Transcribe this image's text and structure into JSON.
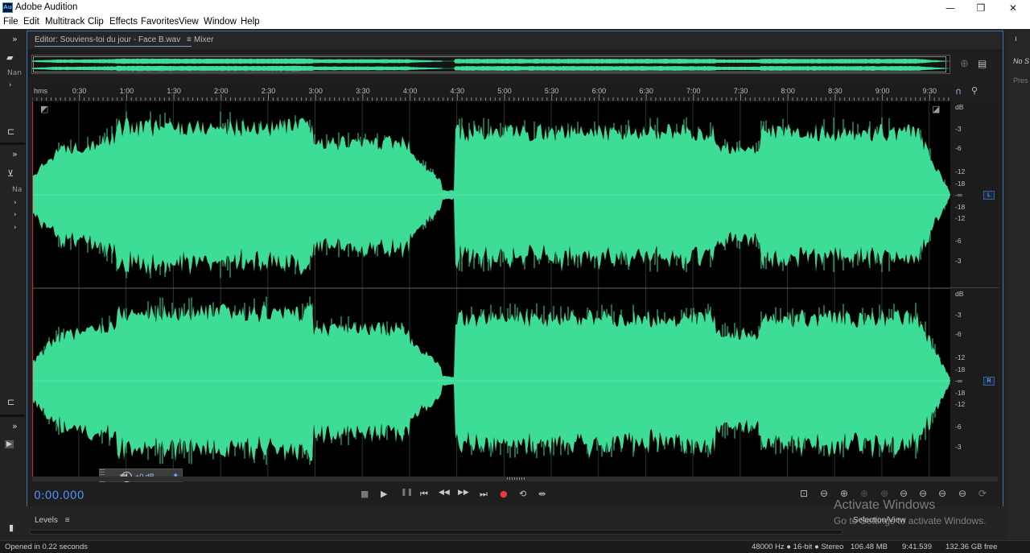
{
  "window": {
    "title": "Adobe Audition",
    "app_icon_text": "Au",
    "minimize_glyph": "—",
    "maximize_glyph": "❐",
    "close_glyph": "✕"
  },
  "menu": [
    "File",
    "Edit",
    "Multitrack",
    "Clip",
    "Effects",
    "Favorites",
    "View",
    "Window",
    "Help"
  ],
  "left_panel": {
    "files_label": "Nan",
    "effects_label": "Na"
  },
  "editor": {
    "tab_label": "Editor: Souviens-toi du jour - Face B.wav",
    "mixer_label": "Mixer",
    "menu_glyph": "≡"
  },
  "ruler": {
    "labels": [
      "hms",
      "0:30",
      "1:00",
      "1:30",
      "2:00",
      "2:30",
      "3:00",
      "3:30",
      "4:00",
      "4:30",
      "5:00",
      "5:30",
      "6:00",
      "6:30",
      "7:00",
      "7:30",
      "8:00",
      "8:30",
      "9:00",
      "9:30"
    ]
  },
  "db_scale": {
    "unit": "dB",
    "left_labels": [
      "-3",
      "-6",
      "-12",
      "-18",
      "-∞",
      "-18",
      "-12",
      "-6",
      "-3"
    ],
    "right_labels": [
      "-3",
      "-6",
      "-12",
      "-18",
      "-∞",
      "-18",
      "-12",
      "-6",
      "-3"
    ],
    "left_channel": "L",
    "right_channel": "R"
  },
  "hud": {
    "volume_value": "+0 dB"
  },
  "transport": {
    "current_time": "0:00.000",
    "buttons": [
      "■",
      "▶",
      "❚❚",
      "⏮",
      "◀◀",
      "▶▶",
      "⏭",
      "●",
      "⟲",
      "⇹"
    ]
  },
  "zoom_buttons": [
    "⊡",
    "⊖",
    "⊕",
    "⊕",
    "⊕",
    "⊖",
    "⊖",
    "⊖",
    "⊖",
    "⟳",
    "⊘"
  ],
  "levels": {
    "tab_label": "Levels",
    "menu_glyph": "≡"
  },
  "selection_view": {
    "label": "Selection/View"
  },
  "right_panel": {
    "label_1": "No S",
    "label_2": "Pres"
  },
  "watermark": {
    "line1": "Activate Windows",
    "line2": "Go to Settings to activate Windows."
  },
  "status": {
    "message": "Opened in 0.22 seconds",
    "format": "48000 Hz ● 16-bit ● Stereo",
    "file_size": "106.48 MB",
    "duration": "9:41.539",
    "disk_free": "132.36 GB free"
  },
  "colors": {
    "waveform": "#3ddc97",
    "accent_blue": "#4c8ff3",
    "record_red": "#e83a3a"
  }
}
